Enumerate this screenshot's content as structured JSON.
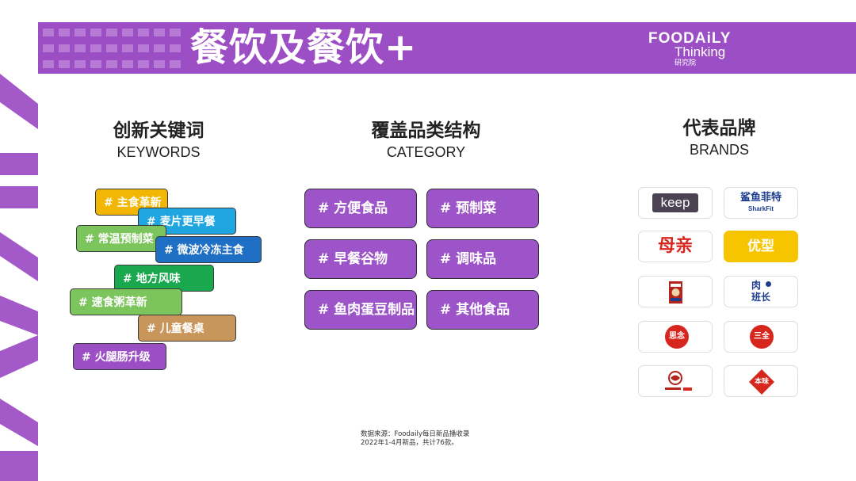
{
  "title": "餐饮及餐饮+",
  "logo": {
    "line1": "FOODAiLY",
    "line2": "Thinking",
    "line3": "研究院"
  },
  "columns": {
    "keywords": {
      "zh": "创新关键词",
      "en": "KEYWORDS"
    },
    "category": {
      "zh": "覆盖品类结构",
      "en": "CATEGORY"
    },
    "brands": {
      "zh": "代表品牌",
      "en": "BRANDS"
    }
  },
  "keywords": [
    {
      "label": "# 主食革新",
      "color": "#f2b705"
    },
    {
      "label": "# 麦片更早餐",
      "color": "#1fa6e0"
    },
    {
      "label": "# 常温预制菜",
      "color": "#7cc45c"
    },
    {
      "label": "# 微波冷冻主食",
      "color": "#1f6fc4"
    },
    {
      "label": "# 地方风味",
      "color": "#1aa84e"
    },
    {
      "label": "# 速食粥革新",
      "color": "#7cc45c"
    },
    {
      "label": "# 儿童餐桌",
      "color": "#c8955a"
    },
    {
      "label": "# 火腿肠升级",
      "color": "#9c4fc4"
    }
  ],
  "categories": [
    {
      "label": "# 方便食品"
    },
    {
      "label": "# 预制菜"
    },
    {
      "label": "# 早餐谷物"
    },
    {
      "label": "# 调味品"
    },
    {
      "label": "# 鱼肉蛋豆制品"
    },
    {
      "label": "# 其他食品"
    }
  ],
  "brands": {
    "keep": "keep",
    "sharkfit_cn": "鲨鱼菲特",
    "sharkfit_en": "SharkFit",
    "muqin": "母亲",
    "youxing": "优型",
    "roubanzhang_1": "肉",
    "roubanzhang_2": "班长",
    "sinian": "思念",
    "sanquan": "三全",
    "benwei": "本味"
  },
  "colors": {
    "brand_purple": "#9c4fc4",
    "youxing_yellow": "#f7c400",
    "red": "#d7261e"
  },
  "source_note": {
    "line1": "数据来源：Foodaily每日新品播收录",
    "line2": "2022年1-4月新品，共计76款。"
  }
}
